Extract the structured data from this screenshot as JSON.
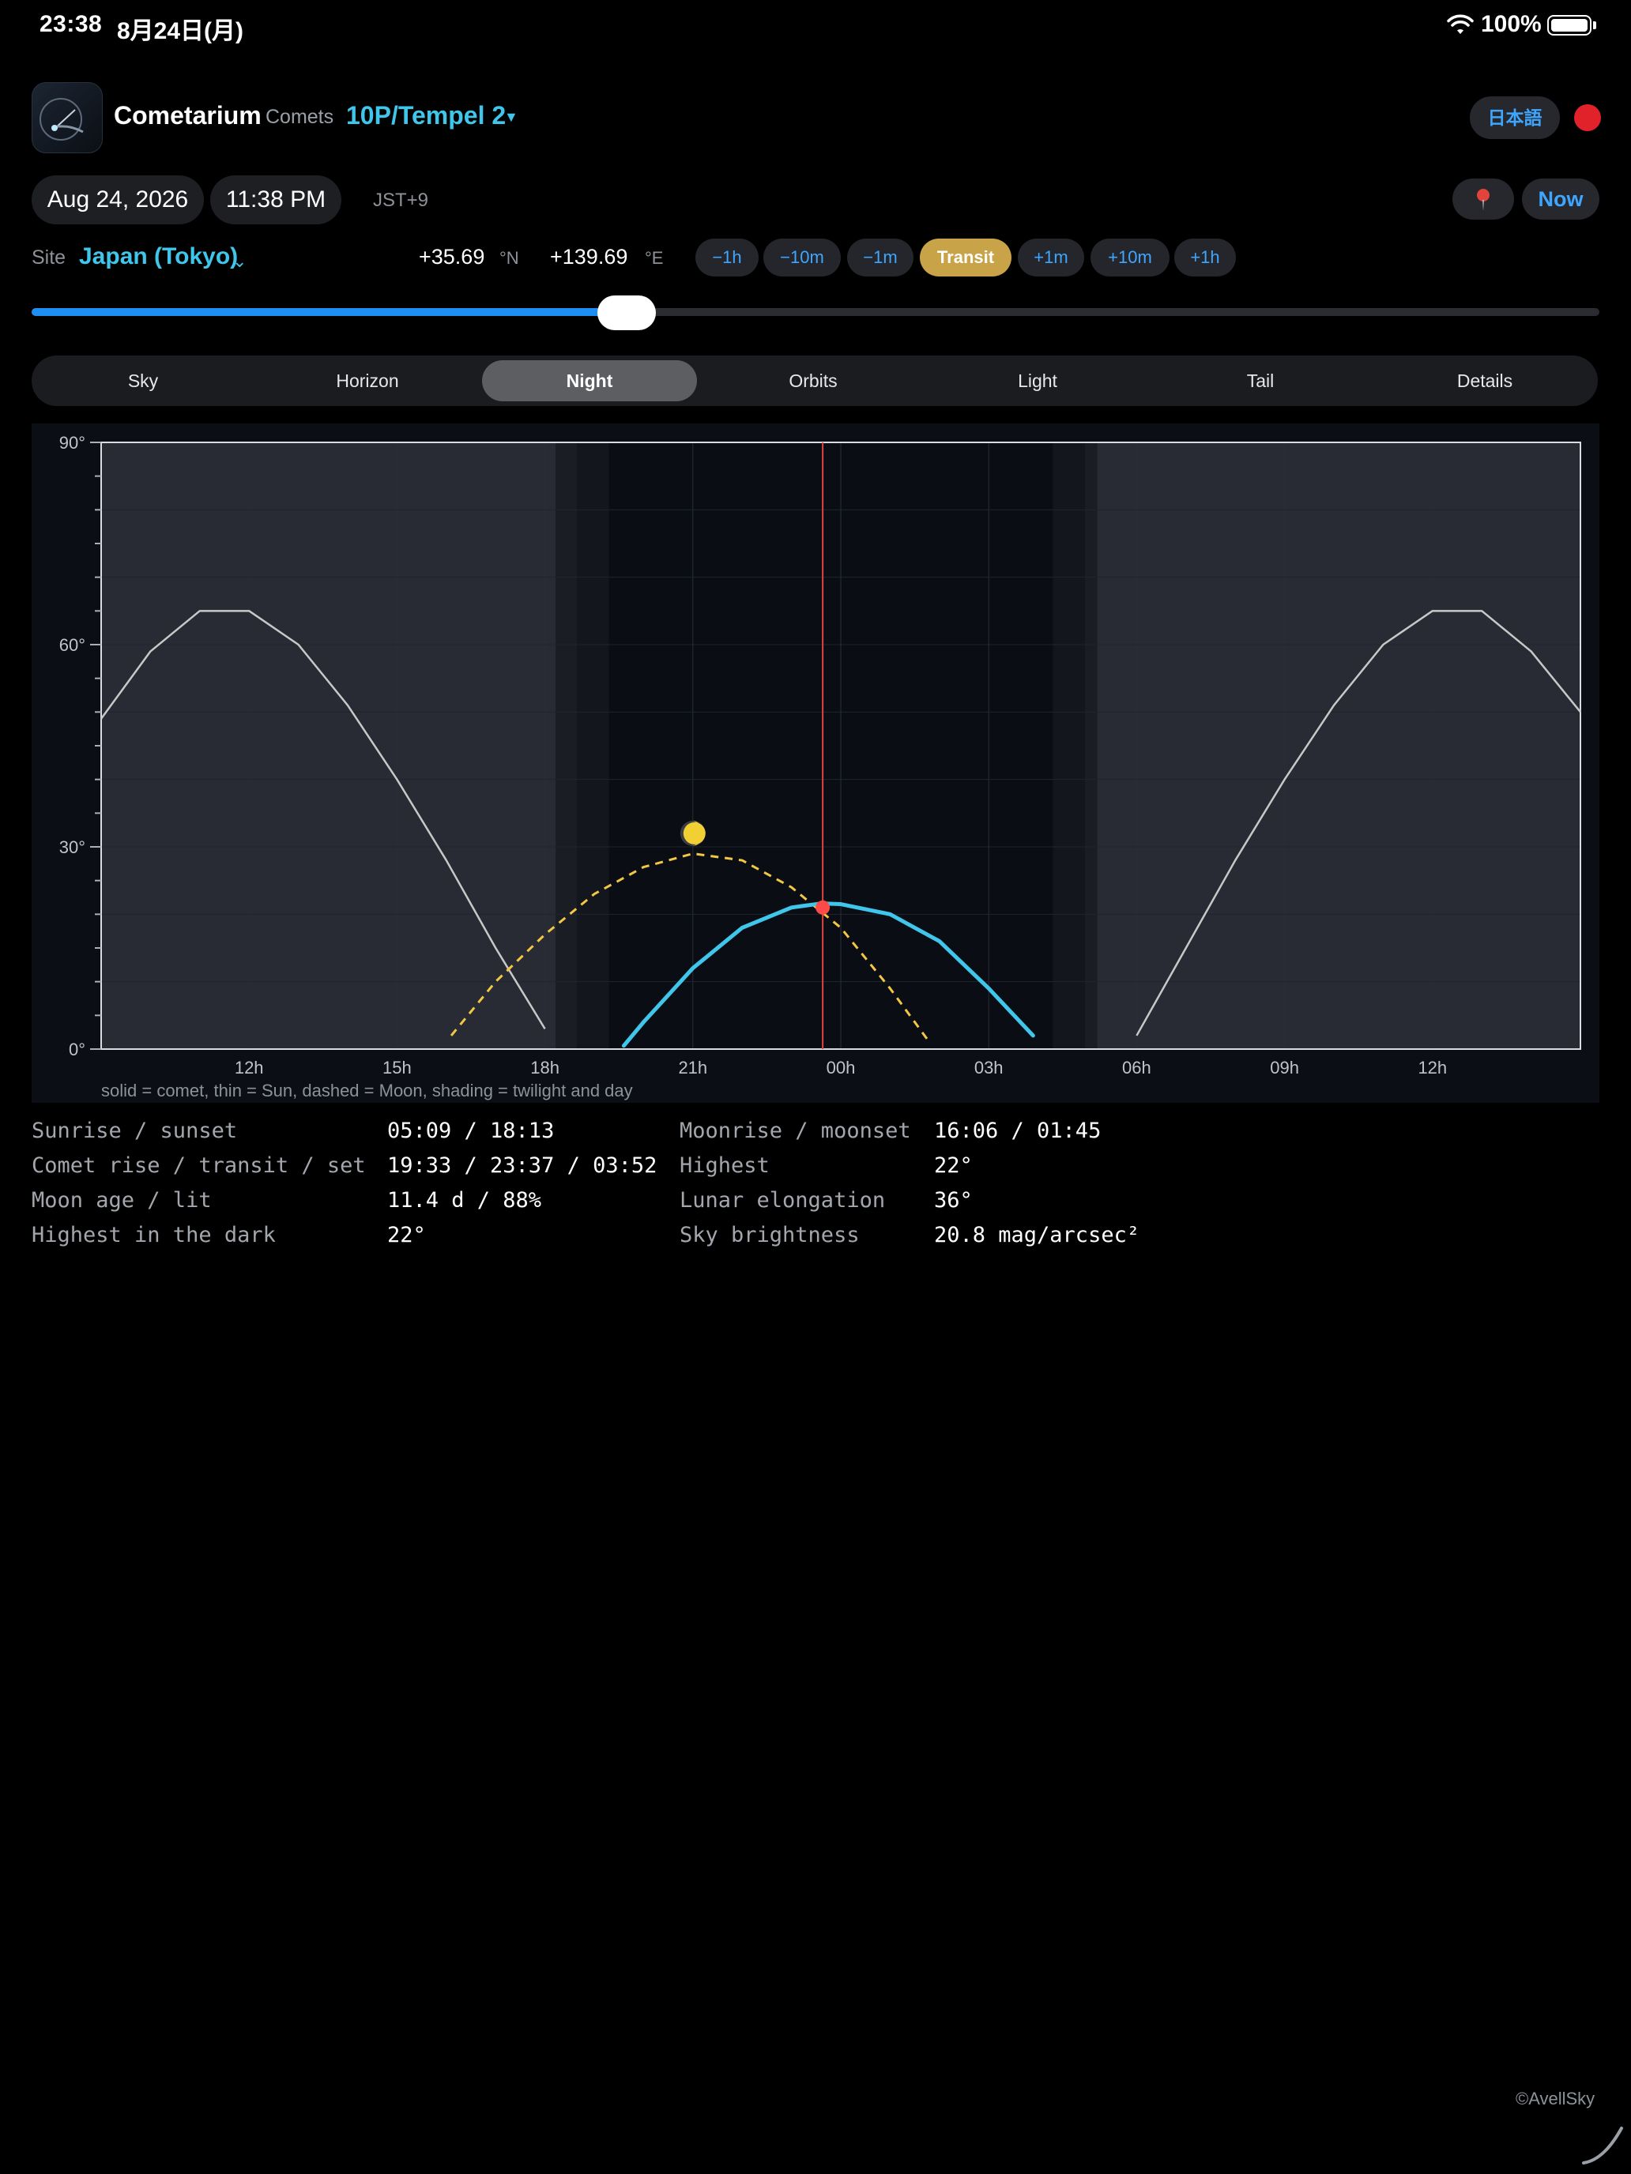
{
  "status_bar": {
    "time": "23:38",
    "date": "8月24日(月)",
    "battery": "100%"
  },
  "header": {
    "app_name": "Cometarium",
    "section": "Comets",
    "comet": "10P/Tempel 2",
    "lang_button": "日本語"
  },
  "datetime": {
    "date": "Aug 24, 2026",
    "time": "11:38 PM",
    "timezone": "JST+9",
    "now_button": "Now"
  },
  "site": {
    "label": "Site",
    "name": "Japan (Tokyo)",
    "lat": "+35.69",
    "lat_unit": "°N",
    "lon": "+139.69",
    "lon_unit": "°E"
  },
  "steps": [
    "−1h",
    "−10m",
    "−1m",
    "Transit",
    "+1m",
    "+10m",
    "+1h"
  ],
  "slider": {
    "fraction": 0.38
  },
  "tabs": [
    "Sky",
    "Horizon",
    "Night",
    "Orbits",
    "Light",
    "Tail",
    "Details"
  ],
  "active_tab": "Night",
  "chart_caption": "solid = comet, thin = Sun, dashed = Moon, shading = twilight and day",
  "colors": {
    "accent": "#3fc6ea",
    "link": "#3fa6ff",
    "transit": "#c9a347",
    "comet": "#3fc6ea",
    "moon": "#f2c744",
    "sun": "#c8c8c8",
    "cursor": "#e04444"
  },
  "chart_data": {
    "type": "line",
    "title": "",
    "xlabel": "",
    "ylabel": "",
    "x_unit": "hours since 09:00 Aug 24",
    "x_ticks": [
      "12h",
      "15h",
      "18h",
      "21h",
      "00h",
      "03h",
      "06h",
      "09h",
      "12h"
    ],
    "y_ticks": [
      "0°",
      "30°",
      "60°",
      "90°"
    ],
    "ylim": [
      0,
      90
    ],
    "grid": true,
    "current_time": "23:38",
    "current_comet_alt": 21,
    "moon_marker": {
      "time": "21:00",
      "alt": 32
    },
    "series": [
      {
        "name": "Sun",
        "style": "thin",
        "x": [
          9.0,
          10,
          11,
          12,
          13,
          14,
          15,
          16,
          17,
          18
        ],
        "y": [
          49,
          59,
          65,
          65,
          60,
          51,
          40,
          28,
          15,
          3
        ]
      },
      {
        "name": "Sun",
        "style": "thin",
        "x": [
          30.0,
          31,
          32,
          33,
          34,
          35,
          36,
          37,
          38,
          39.0
        ],
        "y": [
          2,
          15,
          28,
          40,
          51,
          60,
          65,
          65,
          59,
          50
        ]
      },
      {
        "name": "Moon",
        "style": "dashed",
        "x": [
          16.1,
          17,
          18,
          19,
          20,
          21,
          22,
          23,
          24,
          25,
          25.8
        ],
        "y": [
          2,
          10,
          17,
          23,
          27,
          29,
          28,
          24,
          18,
          9,
          1
        ]
      },
      {
        "name": "Comet",
        "style": "solid",
        "x": [
          19.6,
          20,
          21,
          22,
          23,
          23.6,
          24,
          25,
          26,
          27,
          27.9
        ],
        "y": [
          0.5,
          4,
          12,
          18,
          21,
          21.6,
          21.5,
          20,
          16,
          9,
          2
        ]
      }
    ],
    "shading": "twilight and day"
  },
  "info_table": [
    {
      "label": "Sunrise / sunset",
      "value": "05:09 / 18:13"
    },
    {
      "label": "Comet rise / transit / set",
      "value": "19:33 / 23:37 / 03:52"
    },
    {
      "label": "Moon age / lit",
      "value": "11.4 d / 88%"
    },
    {
      "label": "Highest in the dark",
      "value": "22°"
    },
    {
      "label": "Moonrise / moonset",
      "value": "16:06 / 01:45"
    },
    {
      "label": "Highest",
      "value": "22°"
    },
    {
      "label": "Lunar elongation",
      "value": "36°"
    },
    {
      "label": "Sky brightness",
      "value": "20.8 mag/arcsec²"
    }
  ],
  "credit": "©AvellSky"
}
